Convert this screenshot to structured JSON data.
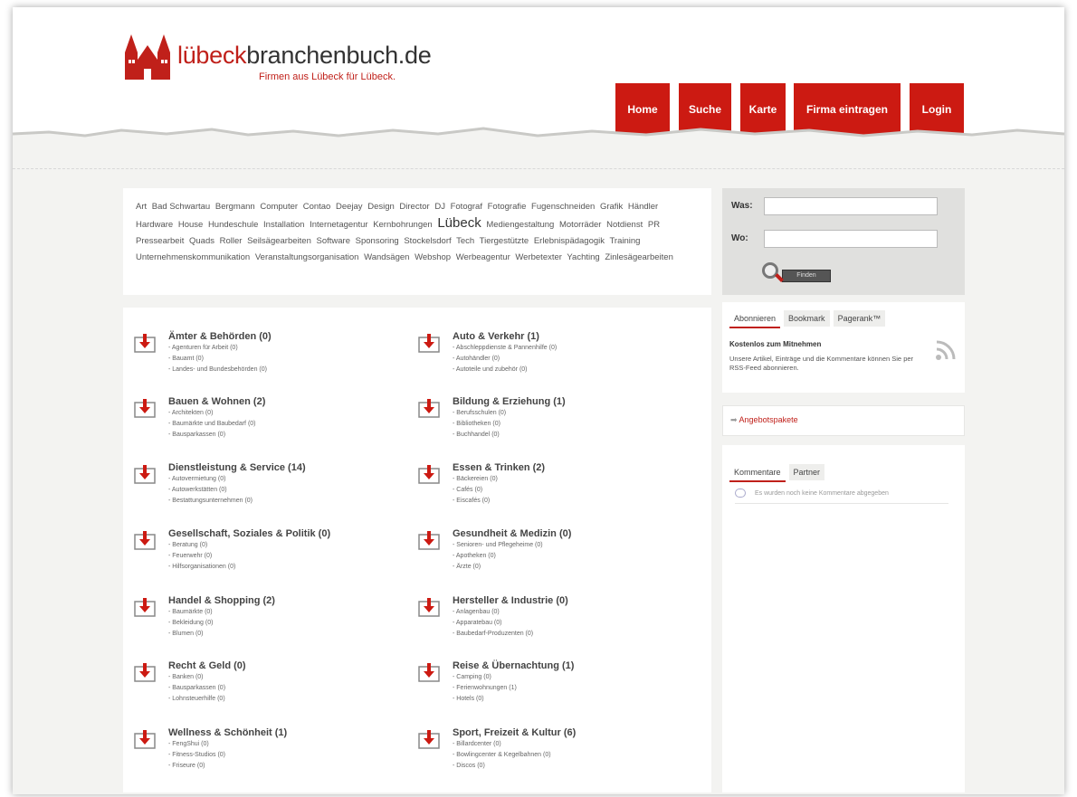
{
  "site": {
    "name_red": "lübeck",
    "name_rest": "branchenbuch.de",
    "tagline": "Firmen aus Lübeck für Lübeck."
  },
  "nav": [
    {
      "label": "Home"
    },
    {
      "label": "Suche"
    },
    {
      "label": "Karte"
    },
    {
      "label": "Firma eintragen"
    },
    {
      "label": "Login"
    }
  ],
  "tags": [
    {
      "label": "Art",
      "big": false
    },
    {
      "label": "Bad Schwartau",
      "big": false
    },
    {
      "label": "Bergmann",
      "big": false
    },
    {
      "label": "Computer",
      "big": false
    },
    {
      "label": "Contao",
      "big": false
    },
    {
      "label": "Deejay",
      "big": false
    },
    {
      "label": "Design",
      "big": false
    },
    {
      "label": "Director",
      "big": false
    },
    {
      "label": "DJ",
      "big": false
    },
    {
      "label": "Fotograf",
      "big": false
    },
    {
      "label": "Fotografie",
      "big": false
    },
    {
      "label": "Fugenschneiden",
      "big": false
    },
    {
      "label": "Grafik",
      "big": false
    },
    {
      "label": "Händler",
      "big": false
    },
    {
      "label": "Hardware",
      "big": false
    },
    {
      "label": "House",
      "big": false
    },
    {
      "label": "Hundeschule",
      "big": false
    },
    {
      "label": "Installation",
      "big": false
    },
    {
      "label": "Internetagentur",
      "big": false
    },
    {
      "label": "Kernbohrungen",
      "big": false
    },
    {
      "label": "Lübeck",
      "big": true
    },
    {
      "label": "Mediengestaltung",
      "big": false
    },
    {
      "label": "Motorräder",
      "big": false
    },
    {
      "label": "Notdienst",
      "big": false
    },
    {
      "label": "PR",
      "big": false
    },
    {
      "label": "Pressearbeit",
      "big": false
    },
    {
      "label": "Quads",
      "big": false
    },
    {
      "label": "Roller",
      "big": false
    },
    {
      "label": "Seilsägearbeiten",
      "big": false
    },
    {
      "label": "Software",
      "big": false
    },
    {
      "label": "Sponsoring",
      "big": false
    },
    {
      "label": "Stockelsdorf",
      "big": false
    },
    {
      "label": "Tech",
      "big": false
    },
    {
      "label": "Tiergestützte",
      "big": false
    },
    {
      "label": "Erlebnispädagogik",
      "big": false
    },
    {
      "label": "Training",
      "big": false
    },
    {
      "label": "Unternehmenskommunikation",
      "big": false
    },
    {
      "label": "Veranstaltungsorganisation",
      "big": false
    },
    {
      "label": "Wandsägen",
      "big": false
    },
    {
      "label": "Webshop",
      "big": false
    },
    {
      "label": "Werbeagentur",
      "big": false
    },
    {
      "label": "Werbetexter",
      "big": false
    },
    {
      "label": "Yachting",
      "big": false
    },
    {
      "label": "Zinlesägearbeiten",
      "big": false
    }
  ],
  "categories": [
    {
      "title": "Ämter & Behörden (0)",
      "subs": [
        "- Agenturen für Arbeit (0)",
        "- Bauamt (0)",
        "- Landes- und Bundesbehörden (0)"
      ]
    },
    {
      "title": "Auto & Verkehr (1)",
      "subs": [
        "- Abschleppdienste & Pannenhilfe (0)",
        "- Autohändler (0)",
        "- Autoteile und zubehör (0)"
      ]
    },
    {
      "title": "Bauen & Wohnen (2)",
      "subs": [
        "- Architekten (0)",
        "- Baumärkte und Baubedarf (0)",
        "- Bausparkassen (0)"
      ]
    },
    {
      "title": "Bildung & Erziehung (1)",
      "subs": [
        "- Berufsschulen (0)",
        "- Bibliotheken (0)",
        "- Buchhandel (0)"
      ]
    },
    {
      "title": "Dienstleistung & Service (14)",
      "subs": [
        "- Autovermietung (0)",
        "- Autowerkstätten (0)",
        "- Bestattungsunternehmen (0)"
      ]
    },
    {
      "title": "Essen & Trinken (2)",
      "subs": [
        "- Bäckereien (0)",
        "- Cafés (0)",
        "- Eiscafés (0)"
      ]
    },
    {
      "title": "Gesellschaft, Soziales & Politik (0)",
      "subs": [
        "- Beratung (0)",
        "- Feuerwehr (0)",
        "- Hilfsorganisationen (0)"
      ]
    },
    {
      "title": "Gesundheit & Medizin (0)",
      "subs": [
        "- Senioren- und Pflegeheime (0)",
        "- Apotheken (0)",
        "- Ärzte (0)"
      ]
    },
    {
      "title": "Handel & Shopping (2)",
      "subs": [
        "- Baumärkte (0)",
        "- Bekleidung (0)",
        "- Blumen (0)"
      ]
    },
    {
      "title": "Hersteller & Industrie (0)",
      "subs": [
        "- Anlagenbau (0)",
        "- Apparatebau (0)",
        "- Baubedarf-Produzenten (0)"
      ]
    },
    {
      "title": "Recht & Geld (0)",
      "subs": [
        "- Banken (0)",
        "- Bausparkassen (0)",
        "- Lohnsteuerhilfe (0)"
      ]
    },
    {
      "title": "Reise & Übernachtung (1)",
      "subs": [
        "- Camping (0)",
        "- Ferienwohnungen (1)",
        "- Hotels (0)"
      ]
    },
    {
      "title": "Wellness & Schönheit (1)",
      "subs": [
        "- FengShui (0)",
        "- Fitness-Studios (0)",
        "- Friseure (0)"
      ]
    },
    {
      "title": "Sport, Freizeit & Kultur (6)",
      "subs": [
        "- Billardcenter (0)",
        "- Bowlingcenter & Kegelbahnen (0)",
        "- Discos (0)"
      ]
    }
  ],
  "search": {
    "was_label": "Was:",
    "wo_label": "Wo:",
    "was_value": "",
    "wo_value": "",
    "button_label": "Finden"
  },
  "rss": {
    "tabs": [
      "Abonnieren",
      "Bookmark",
      "Pagerank™"
    ],
    "title": "Kostenlos zum Mitnehmen",
    "text": "Unsere Artikel, Einträge und die Kommentare können Sie per RSS-Feed abonnieren."
  },
  "offers": {
    "link": "Angebotspakete"
  },
  "comments": {
    "tabs": [
      "Kommentare",
      "Partner"
    ],
    "note": "Es wurden noch keine Kommentare abgegeben"
  },
  "colors": {
    "accent": "#cc1a12",
    "background": "#f3f3f1"
  }
}
